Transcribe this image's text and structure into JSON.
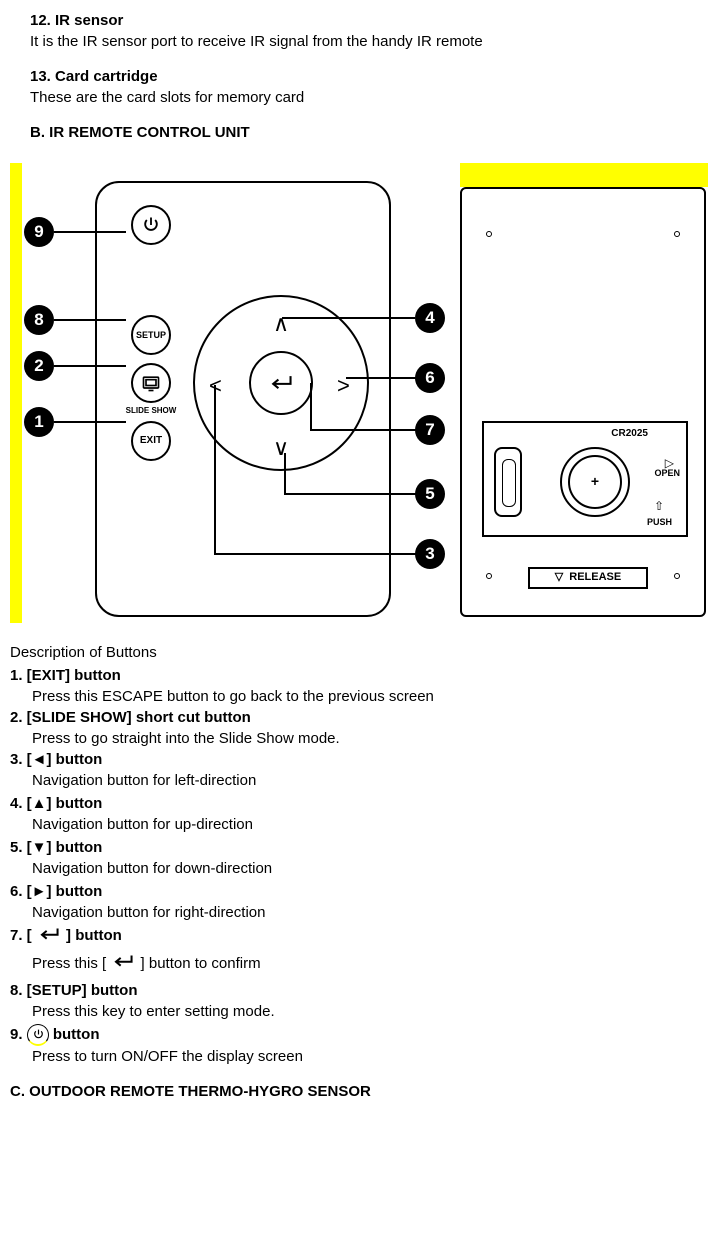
{
  "section12": {
    "title": "12. IR sensor",
    "body": "It is the IR sensor port to receive IR signal from the handy IR remote"
  },
  "section13": {
    "title": "13. Card cartridge",
    "body": "These are the card slots for memory card"
  },
  "headingB": "B. IR REMOTE CONTROL UNIT",
  "remote": {
    "setup": "SETUP",
    "slideshow": "SLIDE SHOW",
    "exit": "EXIT",
    "up": "∧",
    "down": "∨",
    "left": "<",
    "right": ">"
  },
  "callouts": {
    "b1": "1",
    "b2": "2",
    "b3": "3",
    "b4": "4",
    "b5": "5",
    "b6": "6",
    "b7": "7",
    "b8": "8",
    "b9": "9"
  },
  "back": {
    "cr": "CR2025",
    "plus": "+",
    "open": "OPEN",
    "push": "PUSH",
    "release": "RELEASE",
    "openArrow": "▷",
    "pushArrow": "⇧",
    "relTri": "▽"
  },
  "desc": {
    "heading": "Description of Buttons",
    "items": [
      {
        "title": "1. [EXIT] button",
        "body": "Press this ESCAPE button to go back to the previous screen"
      },
      {
        "title": "2. [SLIDE SHOW] short cut button",
        "body": "Press to go straight into the Slide Show mode."
      },
      {
        "title": "3. [◄] button",
        "body": "Navigation button for left-direction"
      },
      {
        "title": "4. [▲] button",
        "body": "Navigation button for up-direction"
      },
      {
        "title": "5. [▼] button",
        "body": "Navigation button for down-direction"
      },
      {
        "title": "6. [►] button",
        "body": "Navigation button for right-direction"
      }
    ],
    "item7title_a": "7. [",
    "item7title_b": "] button",
    "item7body_a": "Press this [",
    "item7body_b": "] button to confirm",
    "item8": {
      "title": "8. [SETUP] button",
      "body": "Press this key to enter setting mode."
    },
    "item9title_a": "9.",
    "item9title_b": "button",
    "item9body": "Press to turn ON/OFF the display screen"
  },
  "headingC": "C. OUTDOOR REMOTE THERMO-HYGRO SENSOR"
}
